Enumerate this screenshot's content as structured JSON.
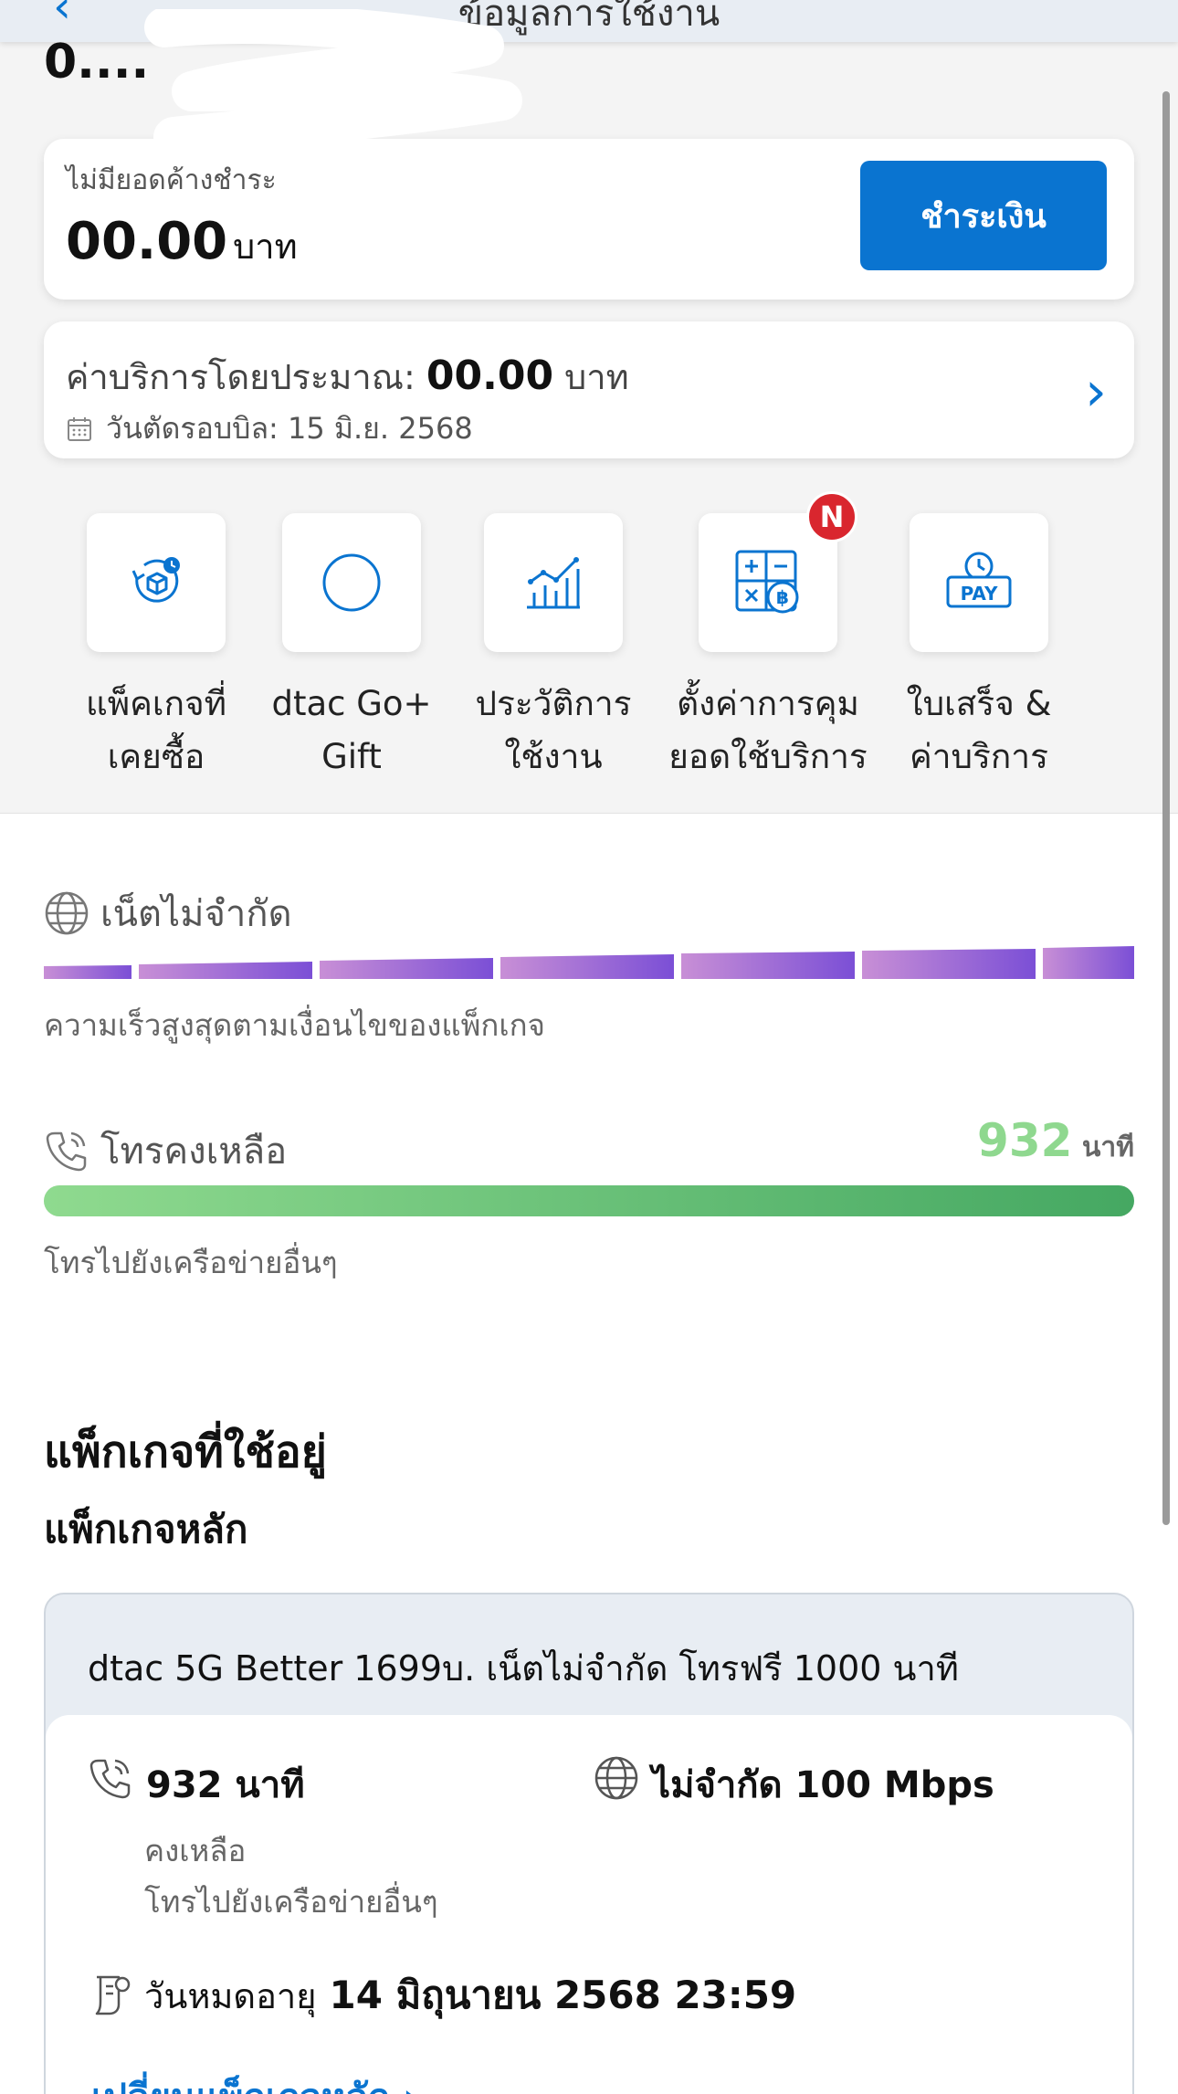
{
  "topbar": {
    "back_icon": "‹",
    "title": "ข้อมูลการใช้งาน"
  },
  "header": {
    "number_partial": "0...."
  },
  "bill": {
    "status": "ไม่มียอดค้างชำระ",
    "amount": "00.00",
    "unit": "บาท",
    "pay_label": "ชำระเงิน"
  },
  "estimate": {
    "label": "ค่าบริการโดยประมาณ:",
    "amount": "00.00",
    "unit": "บาท",
    "cycle_label": "วันตัดรอบบิล: 15 มิ.ย. 2568"
  },
  "shortcuts": [
    {
      "line1": "แพ็คเกจที่",
      "line2": "เคยซื้อ",
      "icon": "package-history-icon"
    },
    {
      "line1": "dtac Go+",
      "line2": "Gift",
      "icon": "circle-icon"
    },
    {
      "line1": "ประวัติการ",
      "line2": "ใช้งาน",
      "icon": "usage-chart-icon"
    },
    {
      "line1": "ตั้งค่าการคุม",
      "line2": "ยอดใช้บริการ",
      "icon": "calculator-baht-icon",
      "badge": "N"
    },
    {
      "line1": "ใบเสร็จ &",
      "line2": "ค่าบริการ",
      "icon": "pay-clock-icon",
      "pay_text": "PAY"
    }
  ],
  "internet": {
    "title": "เน็ตไม่จำกัด",
    "subtitle": "ความเร็วสูงสุดตามเงื่อนไขของแพ็กเกจ",
    "colors": [
      "#c88fd6",
      "#7b4fd6"
    ]
  },
  "calls": {
    "title": "โทรคงเหลือ",
    "value": "932",
    "unit": "นาที",
    "subtitle": "โทรไปยังเครือข่ายอื่นๆ",
    "fill_fraction": 1.0
  },
  "packages": {
    "heading": "แพ็กเกจที่ใช้อยู่",
    "sub_heading": "แพ็กเกจหลัก",
    "main": {
      "name": "dtac 5G Better 1699บ. เน็ตไม่จำกัด โทรฟรี 1000 นาที",
      "call_amount": "932 นาที",
      "call_remaining": "คงเหลือ",
      "call_desc": "โทรไปยังเครือข่ายอื่นๆ",
      "data_amount": "ไม่จำกัด 100 Mbps",
      "expiry_label": "วันหมดอายุ",
      "expiry_value": "14 มิถุนายน 2568 23:59",
      "change_link": "เปลี่ยนแพ็กเกจหลัก"
    }
  },
  "colors": {
    "accent": "#0a74d0",
    "badge": "#d9262e",
    "call_green": "#8fd88f"
  }
}
